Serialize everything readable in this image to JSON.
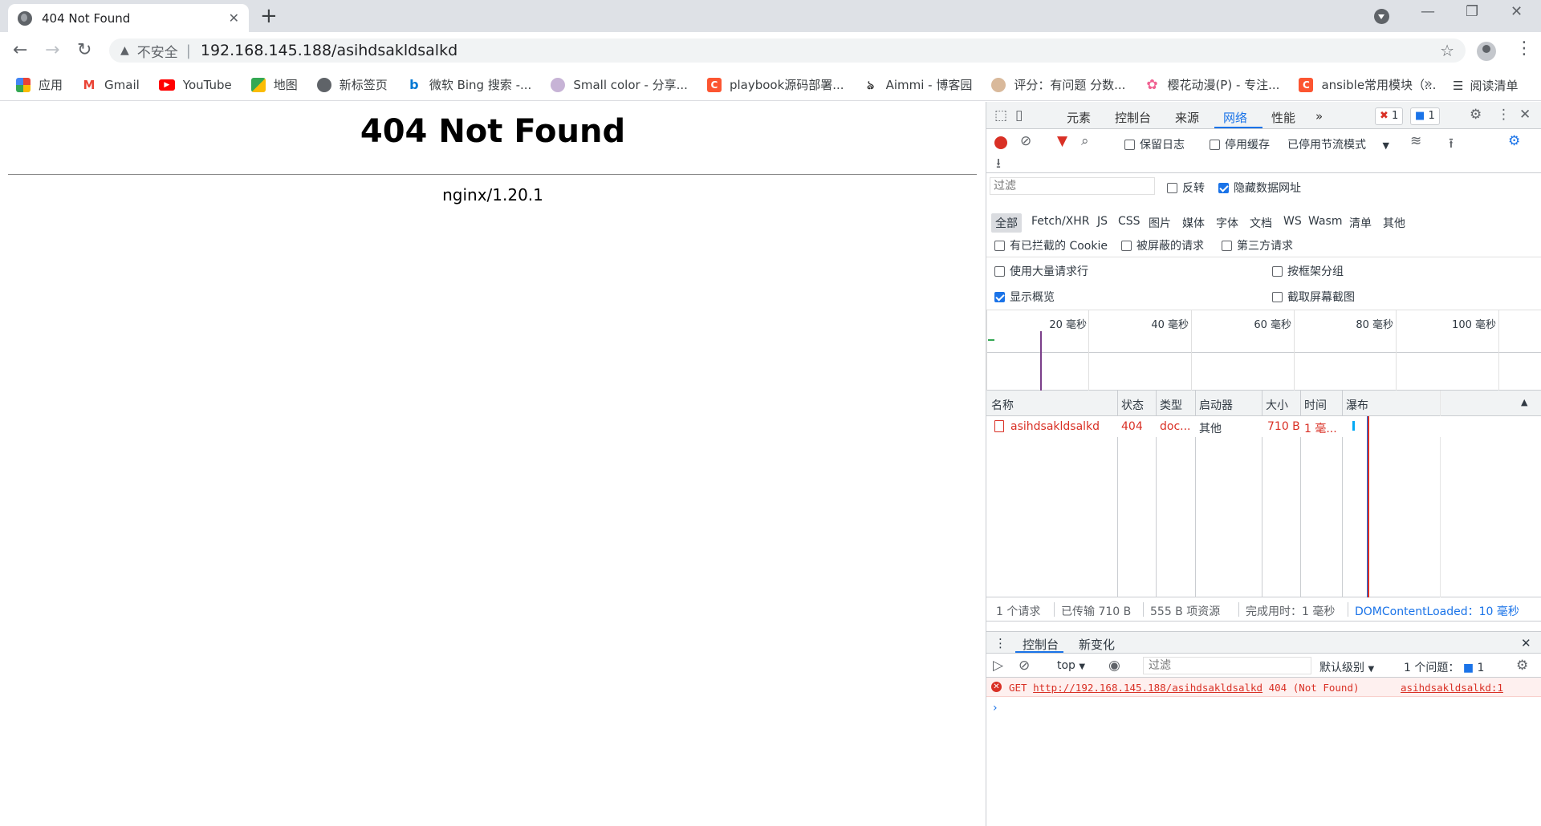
{
  "tab": {
    "title": "404 Not Found",
    "close": "✕"
  },
  "window": {
    "new_tab": "+",
    "minimize": "—",
    "restore": "❐",
    "close": "✕"
  },
  "toolbar": {
    "back": "←",
    "forward": "→",
    "reload": "↻",
    "security_label": "不安全",
    "separator": "|",
    "url": "192.168.145.188/asihdsakldsalkd",
    "star": "☆",
    "menu": "⋮"
  },
  "bookmarks": {
    "items": [
      {
        "label": "应用",
        "icon": "apps-grid-icon",
        "color": "#1a73e8"
      },
      {
        "label": "Gmail",
        "icon": "gmail-icon",
        "color": "#ea4335"
      },
      {
        "label": "YouTube",
        "icon": "youtube-icon",
        "color": "#ff0000"
      },
      {
        "label": "地图",
        "icon": "maps-icon",
        "color": "#34a853"
      },
      {
        "label": "新标签页",
        "icon": "globe-icon",
        "color": "#5f6368"
      },
      {
        "label": "微软 Bing 搜索 -...",
        "icon": "bing-icon",
        "color": "#0078d4"
      },
      {
        "label": "Small color - 分享...",
        "icon": "small-color-icon",
        "color": "#9c7fb3"
      },
      {
        "label": "playbook源码部署...",
        "icon": "csdn-icon",
        "color": "#fc5531"
      },
      {
        "label": "Aimmi - 博客园",
        "icon": "aimmi-icon",
        "color": "#333333"
      },
      {
        "label": "评分：有问题 分数...",
        "icon": "avatar-icon",
        "color": "#b88c6a"
      },
      {
        "label": "樱花动漫(P) - 专注...",
        "icon": "sakura-icon",
        "color": "#f06292"
      },
      {
        "label": "ansible常用模块（...",
        "icon": "csdn-icon",
        "color": "#fc5531"
      }
    ],
    "more": "»",
    "reader": "阅读清单"
  },
  "page": {
    "heading": "404 Not Found",
    "server": "nginx/1.20.1"
  },
  "devtools": {
    "tabs": [
      "元素",
      "控制台",
      "来源",
      "网络",
      "性能"
    ],
    "active_tab": "网络",
    "more_tabs": "»",
    "error_count": "1",
    "issue_count": "1",
    "network": {
      "preserve_log": "保留日志",
      "disable_cache": "停用缓存",
      "throttling": "已停用节流模式",
      "filter_placeholder": "过滤",
      "invert": "反转",
      "hide_data_urls": "隐藏数据网址",
      "types": [
        "全部",
        "Fetch/XHR",
        "JS",
        "CSS",
        "图片",
        "媒体",
        "字体",
        "文档",
        "WS",
        "Wasm",
        "清单",
        "其他"
      ],
      "blocked_cookies": "有已拦截的 Cookie",
      "blocked_requests": "被屏蔽的请求",
      "third_party": "第三方请求",
      "large_rows": "使用大量请求行",
      "group_by_frame": "按框架分组",
      "show_overview": "显示概览",
      "screenshots": "截取屏幕截图",
      "overview_ticks": [
        "20 毫秒",
        "40 毫秒",
        "60 毫秒",
        "80 毫秒",
        "100 毫秒"
      ],
      "columns": [
        "名称",
        "状态",
        "类型",
        "启动器",
        "大小",
        "时间",
        "瀑布"
      ],
      "rows": [
        {
          "name": "asihdsakldsalkd",
          "status": "404",
          "type": "doc...",
          "initiator": "其他",
          "size": "710 B",
          "time": "1 毫..."
        }
      ],
      "summary": {
        "requests": "1 个请求",
        "transferred": "已传输 710 B",
        "resources": "555 B 项资源",
        "finish": "完成用时：1 毫秒",
        "dcl": "DOMContentLoaded：10 毫秒"
      }
    },
    "drawer": {
      "tabs": [
        "控制台",
        "新变化"
      ],
      "context": "top",
      "filter_placeholder": "过滤",
      "level": "默认级别",
      "issues": "1 个问题：",
      "issues_count": "1",
      "error": {
        "method": "GET",
        "url": "http://192.168.145.188/asihdsakldsalkd",
        "status": "404 (Not Found)",
        "source": "asihdsakldsalkd:1"
      },
      "prompt": "›"
    }
  }
}
